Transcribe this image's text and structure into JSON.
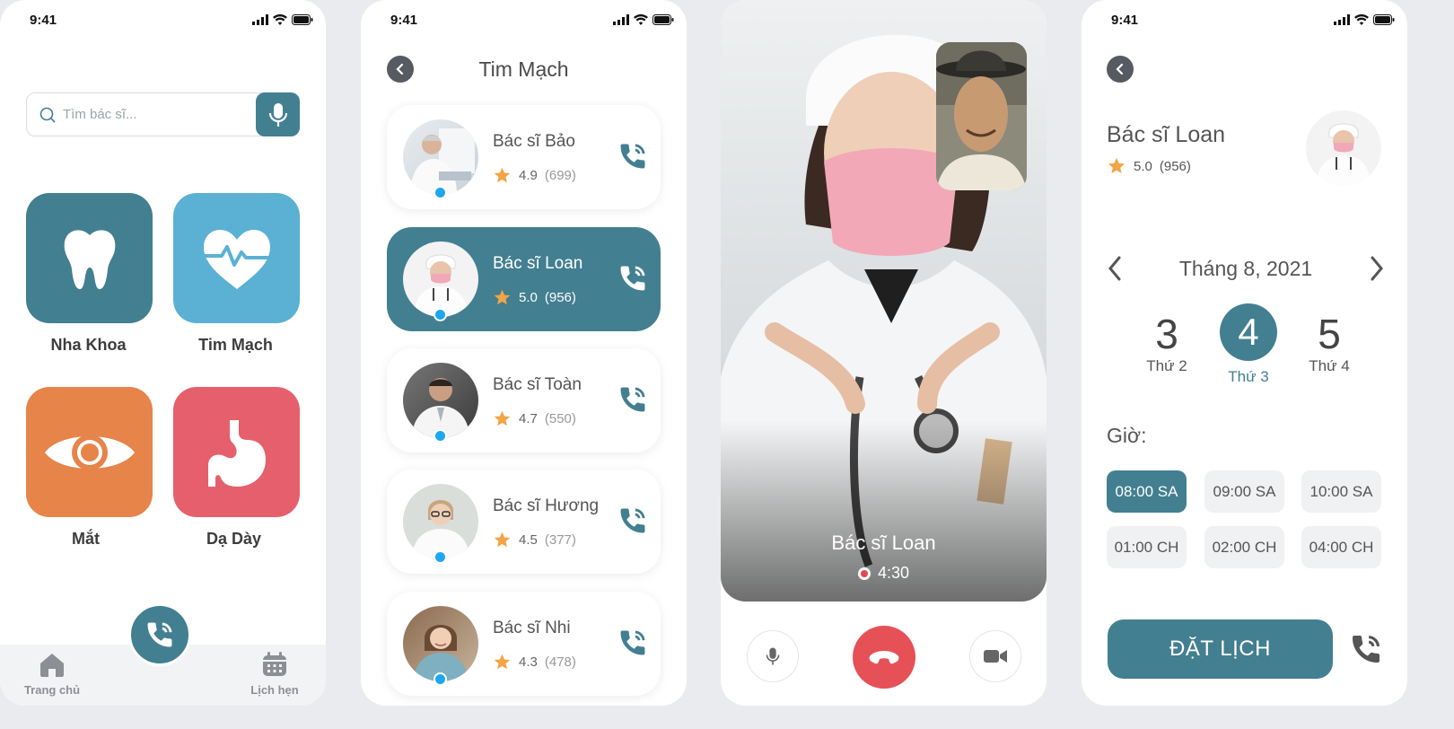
{
  "status": {
    "time": "9:41"
  },
  "home": {
    "search_placeholder": "Tìm bác sĩ...",
    "categories": [
      {
        "label": "Nha Khoa",
        "color": "#427f91",
        "icon": "tooth-icon"
      },
      {
        "label": "Tim Mạch",
        "color": "#5ab1d4",
        "icon": "heart-pulse-icon"
      },
      {
        "label": "Mắt",
        "color": "#e6844a",
        "icon": "eye-icon"
      },
      {
        "label": "Dạ Dày",
        "color": "#e65f6c",
        "icon": "stomach-icon"
      }
    ],
    "nav": {
      "home": "Trang chủ",
      "schedule": "Lịch hẹn"
    }
  },
  "doctors_screen": {
    "title": "Tim Mạch",
    "doctors": [
      {
        "name": "Bác sĩ Bảo",
        "rating": "4.9",
        "count": "(699)"
      },
      {
        "name": "Bác sĩ Loan",
        "rating": "5.0",
        "count": "(956)"
      },
      {
        "name": "Bác sĩ Toàn",
        "rating": "4.7",
        "count": "(550)"
      },
      {
        "name": "Bác sĩ Hương",
        "rating": "4.5",
        "count": "(377)"
      },
      {
        "name": "Bác sĩ Nhi",
        "rating": "4.3",
        "count": "(478)"
      }
    ],
    "selected_index": 1
  },
  "call_screen": {
    "doctor": "Bác sĩ Loan",
    "timer": "4:30"
  },
  "booking": {
    "doctor": "Bác sĩ Loan",
    "rating": "5.0",
    "count": "(956)",
    "month": "Tháng 8, 2021",
    "days": [
      {
        "num": "3",
        "weekday": "Thứ 2"
      },
      {
        "num": "4",
        "weekday": "Thứ 3"
      },
      {
        "num": "5",
        "weekday": "Thứ 4"
      }
    ],
    "hours_label": "Giờ:",
    "slots": [
      "08:00 SA",
      "09:00 SA",
      "10:00 SA",
      "01:00 CH",
      "02:00 CH",
      "04:00 CH"
    ],
    "book_label": "ĐẶT LỊCH"
  },
  "colors": {
    "primary": "#427f91",
    "online": "#1ea7ef",
    "star": "#f3a446",
    "hangup": "#e65057"
  }
}
